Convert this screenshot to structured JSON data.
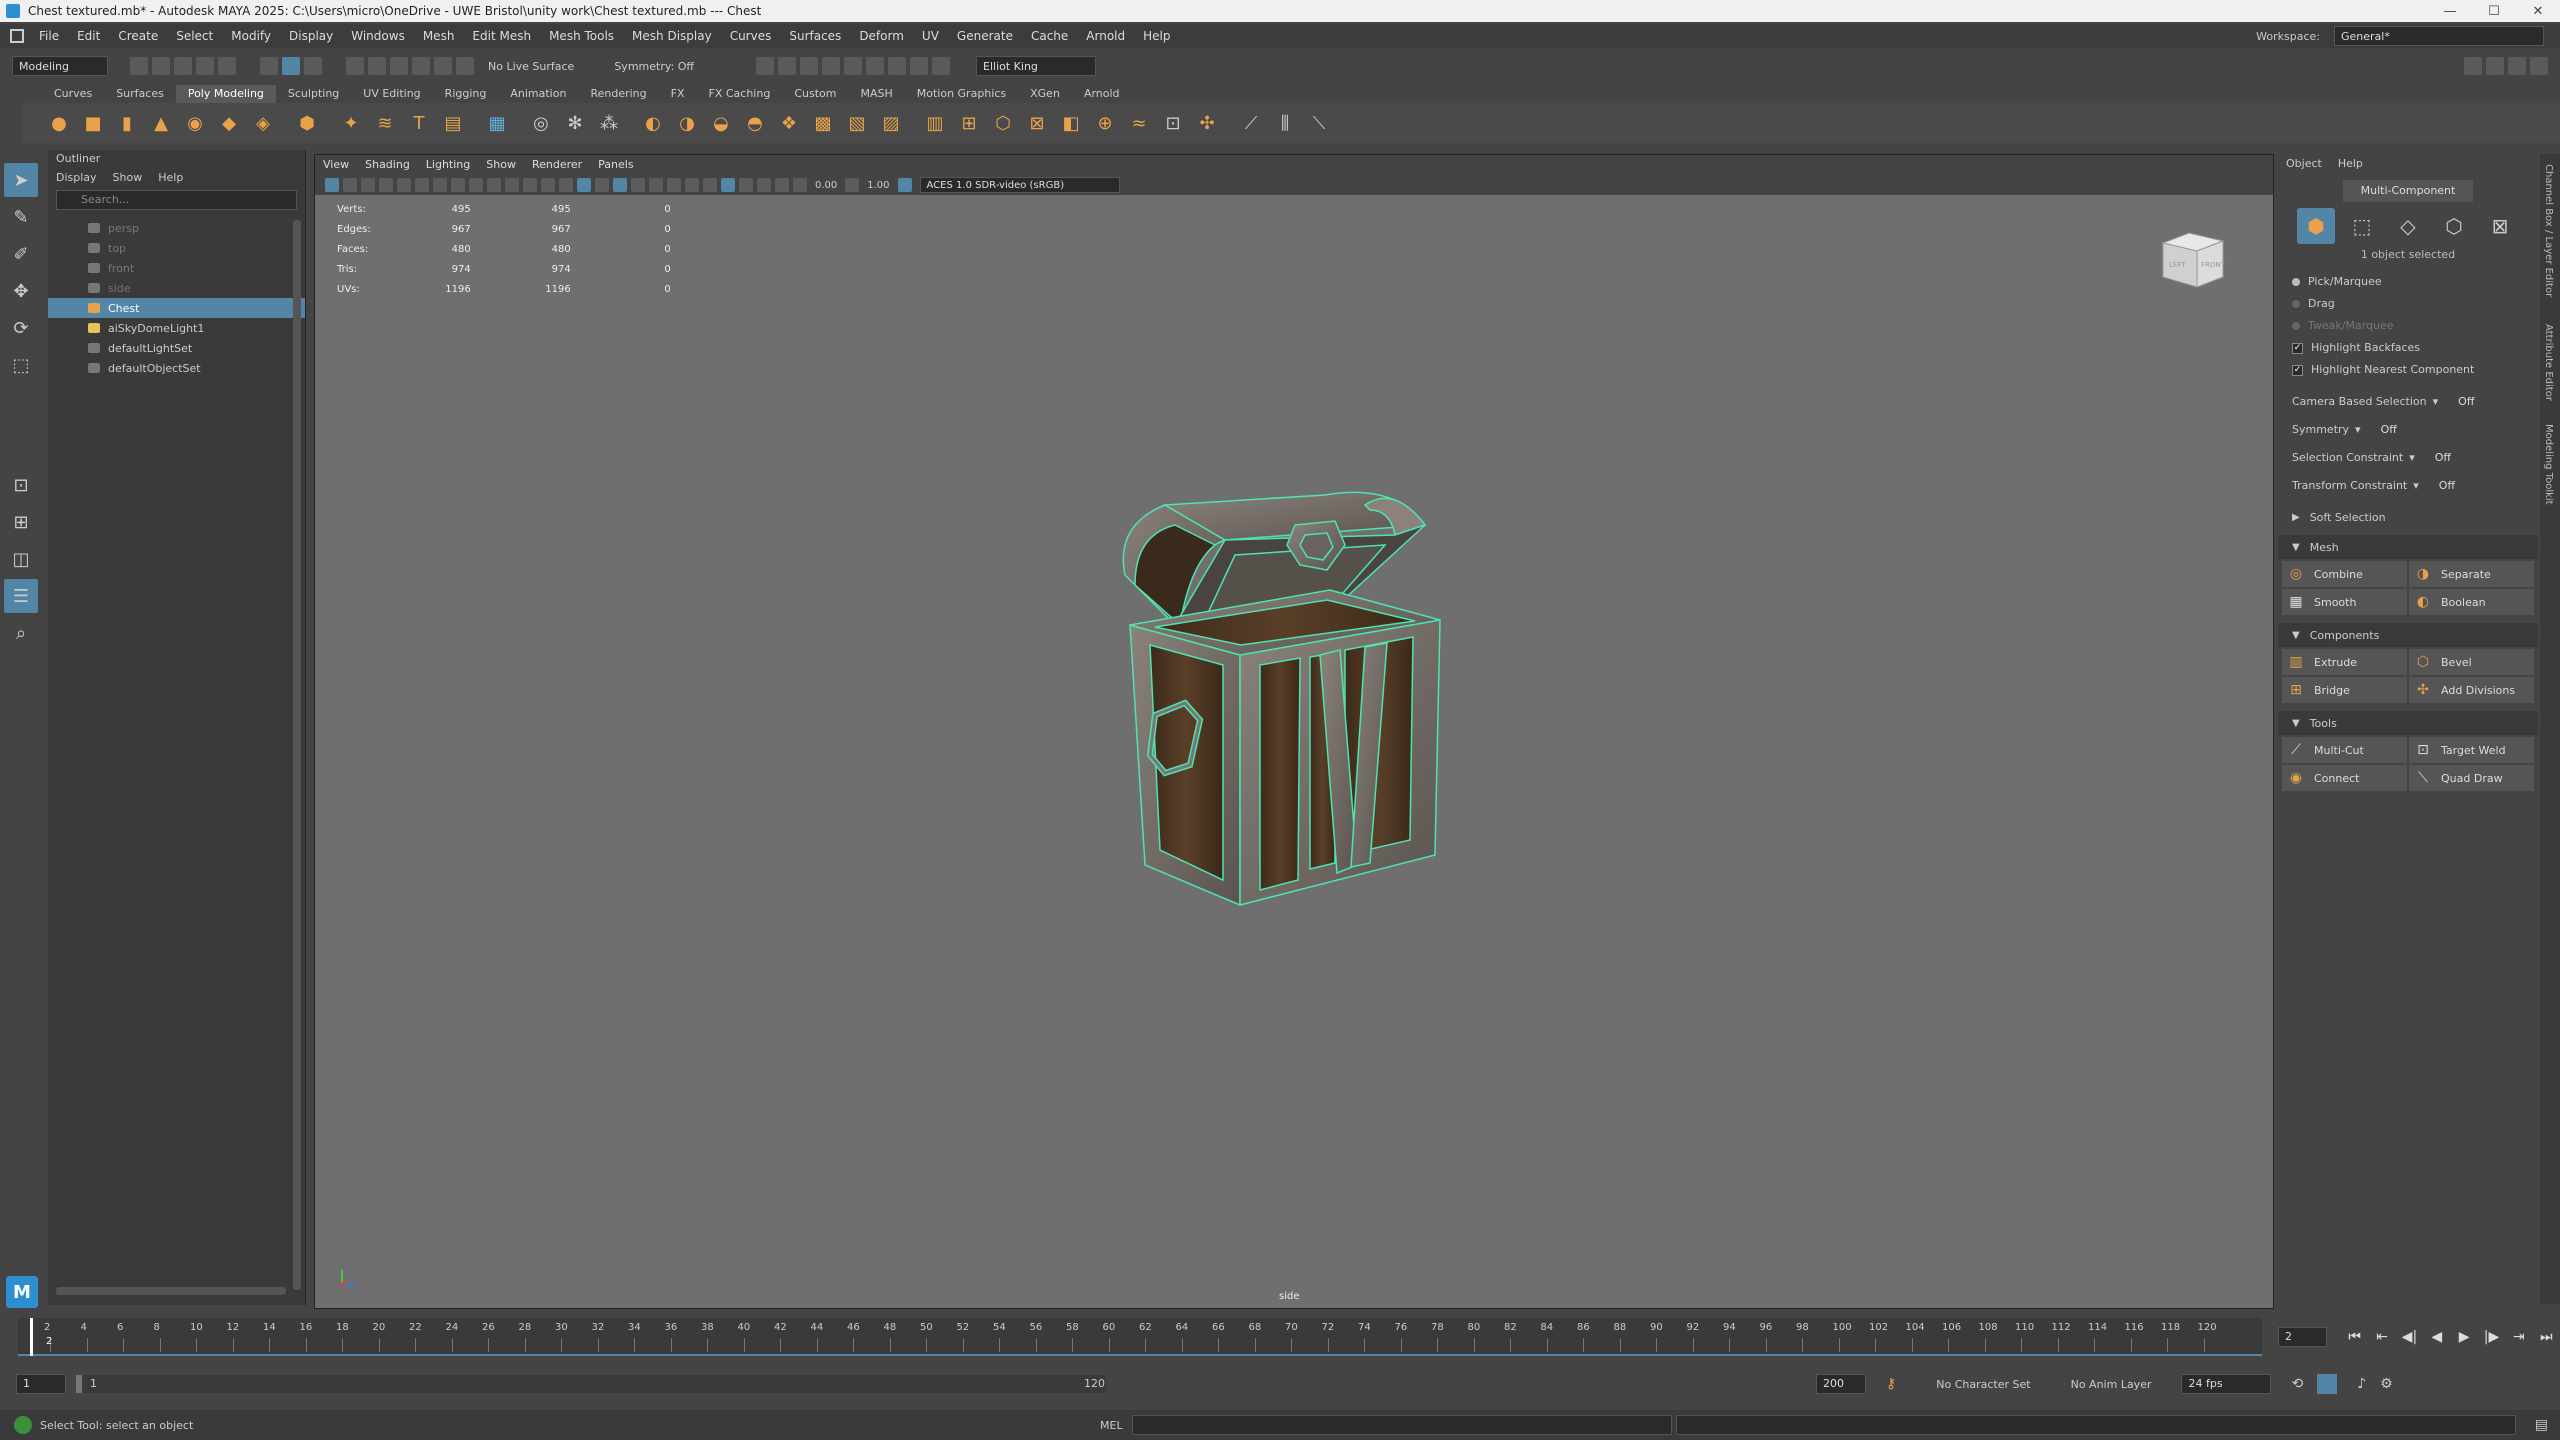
{
  "window": {
    "title": "Chest textured.mb* - Autodesk MAYA 2025: C:\\Users\\micro\\OneDrive - UWE Bristol\\unity work\\Chest textured.mb  ---  Chest",
    "min": "—",
    "max": "☐",
    "close": "✕"
  },
  "menu": [
    "File",
    "Edit",
    "Create",
    "Select",
    "Modify",
    "Display",
    "Windows",
    "Mesh",
    "Edit Mesh",
    "Mesh Tools",
    "Mesh Display",
    "Curves",
    "Surfaces",
    "Deform",
    "UV",
    "Generate",
    "Cache",
    "Arnold",
    "Help"
  ],
  "workspace": {
    "label": "Workspace:",
    "value": "General*"
  },
  "statusline": {
    "mode": "Modeling",
    "live_surface": "No Live Surface",
    "symmetry": "Symmetry: Off",
    "user": "Elliot King"
  },
  "shelf_tabs": [
    "Curves",
    "Surfaces",
    "Poly Modeling",
    "Sculpting",
    "UV Editing",
    "Rigging",
    "Animation",
    "Rendering",
    "FX",
    "FX Caching",
    "Custom",
    "MASH",
    "Motion Graphics",
    "XGen",
    "Arnold"
  ],
  "shelf_active": "Poly Modeling",
  "outliner": {
    "title": "Outliner",
    "menu": [
      "Display",
      "Show",
      "Help"
    ],
    "search_placeholder": "Search...",
    "items": [
      {
        "label": "persp",
        "state": "dim"
      },
      {
        "label": "top",
        "state": "dim"
      },
      {
        "label": "front",
        "state": "dim"
      },
      {
        "label": "side",
        "state": "dim"
      },
      {
        "label": "Chest",
        "state": "selected"
      },
      {
        "label": "aiSkyDomeLight1",
        "state": "normal"
      },
      {
        "label": "defaultLightSet",
        "state": "normal"
      },
      {
        "label": "defaultObjectSet",
        "state": "normal"
      }
    ]
  },
  "viewport": {
    "menu": [
      "View",
      "Shading",
      "Lighting",
      "Show",
      "Renderer",
      "Panels"
    ],
    "val1": "0.00",
    "val2": "1.00",
    "colorspace": "ACES 1.0 SDR-video (sRGB)",
    "camera_label": "side",
    "cube_left": "LEFT",
    "cube_front": "FRONT",
    "hud": [
      {
        "label": "Verts:",
        "a": "495",
        "b": "495",
        "c": "0"
      },
      {
        "label": "Edges:",
        "a": "967",
        "b": "967",
        "c": "0"
      },
      {
        "label": "Faces:",
        "a": "480",
        "b": "480",
        "c": "0"
      },
      {
        "label": "Tris:",
        "a": "974",
        "b": "974",
        "c": "0"
      },
      {
        "label": "UVs:",
        "a": "1196",
        "b": "1196",
        "c": "0"
      }
    ]
  },
  "modeling_toolkit": {
    "tabs": [
      "Object",
      "Help"
    ],
    "multi_component": "Multi-Component",
    "selected_text": "1 object selected",
    "options": [
      {
        "label": "Pick/Marquee",
        "type": "radio",
        "on": true
      },
      {
        "label": "Drag",
        "type": "radio",
        "on": false
      },
      {
        "label": "Tweak/Marquee",
        "type": "radio",
        "on": false
      },
      {
        "label": "Highlight Backfaces",
        "type": "check",
        "on": true
      },
      {
        "label": "Highlight Nearest Component",
        "type": "check",
        "on": true
      }
    ],
    "settings": [
      {
        "label": "Camera Based Selection",
        "value": "Off"
      },
      {
        "label": "Symmetry",
        "value": "Off"
      },
      {
        "label": "Selection Constraint",
        "value": "Off"
      },
      {
        "label": "Transform Constraint",
        "value": "Off"
      }
    ],
    "soft_selection": "Soft Selection",
    "sections": [
      {
        "title": "Mesh",
        "buttons": [
          "Combine",
          "Separate",
          "Smooth",
          "Boolean"
        ]
      },
      {
        "title": "Components",
        "buttons": [
          "Extrude",
          "Bevel",
          "Bridge",
          "Add Divisions"
        ]
      },
      {
        "title": "Tools",
        "buttons": [
          "Multi-Cut",
          "Target Weld",
          "Connect",
          "Quad Draw"
        ]
      }
    ]
  },
  "side_tabs": [
    "Channel Box / Layer Editor",
    "Attribute Editor",
    "Modeling Toolkit"
  ],
  "timeline": {
    "ticks": [
      "2",
      "4",
      "6",
      "8",
      "10",
      "12",
      "14",
      "16",
      "18",
      "20",
      "22",
      "24",
      "26",
      "28",
      "30",
      "32",
      "34",
      "36",
      "38",
      "40",
      "42",
      "44",
      "46",
      "48",
      "50",
      "52",
      "54",
      "56",
      "58",
      "60",
      "62",
      "64",
      "66",
      "68",
      "70",
      "72",
      "74",
      "76",
      "78",
      "80",
      "82",
      "84",
      "86",
      "88",
      "90",
      "92",
      "94",
      "96",
      "98",
      "100",
      "102",
      "104",
      "106",
      "108",
      "110",
      "112",
      "114",
      "116",
      "118",
      "120"
    ],
    "current_frame": "2",
    "current_box": "2"
  },
  "range": {
    "start": "1",
    "inner_start": "1",
    "inner_end": "120",
    "end": "200",
    "character_set": "No Character Set",
    "anim_layer": "No Anim Layer",
    "fps": "24 fps"
  },
  "command": {
    "help": "Select Tool: select an object",
    "lang": "MEL"
  },
  "colors": {
    "accent": "#5285a6",
    "wire": "#4fe3b0",
    "orange": "#e9a249"
  }
}
